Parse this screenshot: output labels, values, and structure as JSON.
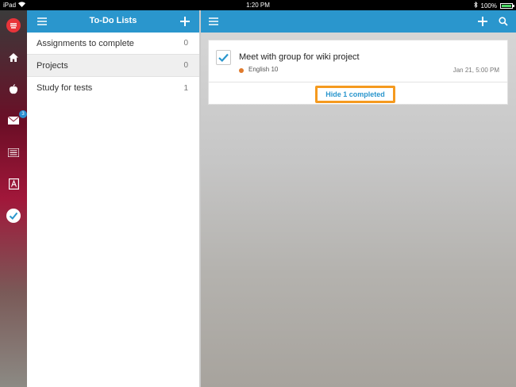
{
  "status_bar": {
    "device": "iPad",
    "time": "1:20 PM",
    "battery": "100%",
    "battery_level": 1.0
  },
  "rail": {
    "mail_badge": "3",
    "icons": [
      "logo-icon",
      "home-icon",
      "apple-icon",
      "mail-icon",
      "list-icon",
      "grades-icon",
      "todo-check-icon"
    ]
  },
  "list_panel": {
    "title": "To-Do Lists",
    "items": [
      {
        "label": "Assignments to complete",
        "count": "0"
      },
      {
        "label": "Projects",
        "count": "0"
      },
      {
        "label": "Study for tests",
        "count": "1"
      }
    ]
  },
  "task": {
    "title": "Meet with group for wiki project",
    "course": "English 10",
    "due": "Jan 21, 5:00 PM",
    "completed": true
  },
  "hide_completed_label": "Hide 1 completed",
  "colors": {
    "accent": "#2a96cd",
    "highlight": "#f59a1f",
    "course_dot": "#e07a2c",
    "logo_red": "#e8343a"
  }
}
